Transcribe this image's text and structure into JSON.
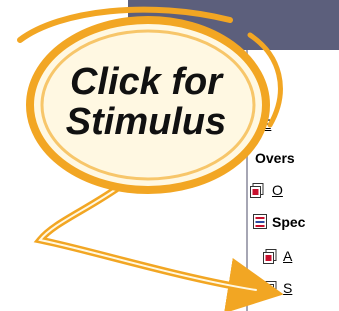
{
  "panel": {
    "items": [
      {
        "kind": "link",
        "label": "E"
      },
      {
        "kind": "section",
        "label": "Overs"
      },
      {
        "kind": "link",
        "label": "O"
      },
      {
        "kind": "section",
        "label": "Spec"
      },
      {
        "kind": "link",
        "label": "A"
      },
      {
        "kind": "link",
        "label": "S"
      }
    ]
  },
  "callout": {
    "line1": "Click for",
    "line2": "Stimulus"
  },
  "colors": {
    "topbar": "#5c5f7c",
    "callout_fill": "#fff8e2",
    "callout_stroke": "#f2a623",
    "icon_red": "#c8102e"
  }
}
